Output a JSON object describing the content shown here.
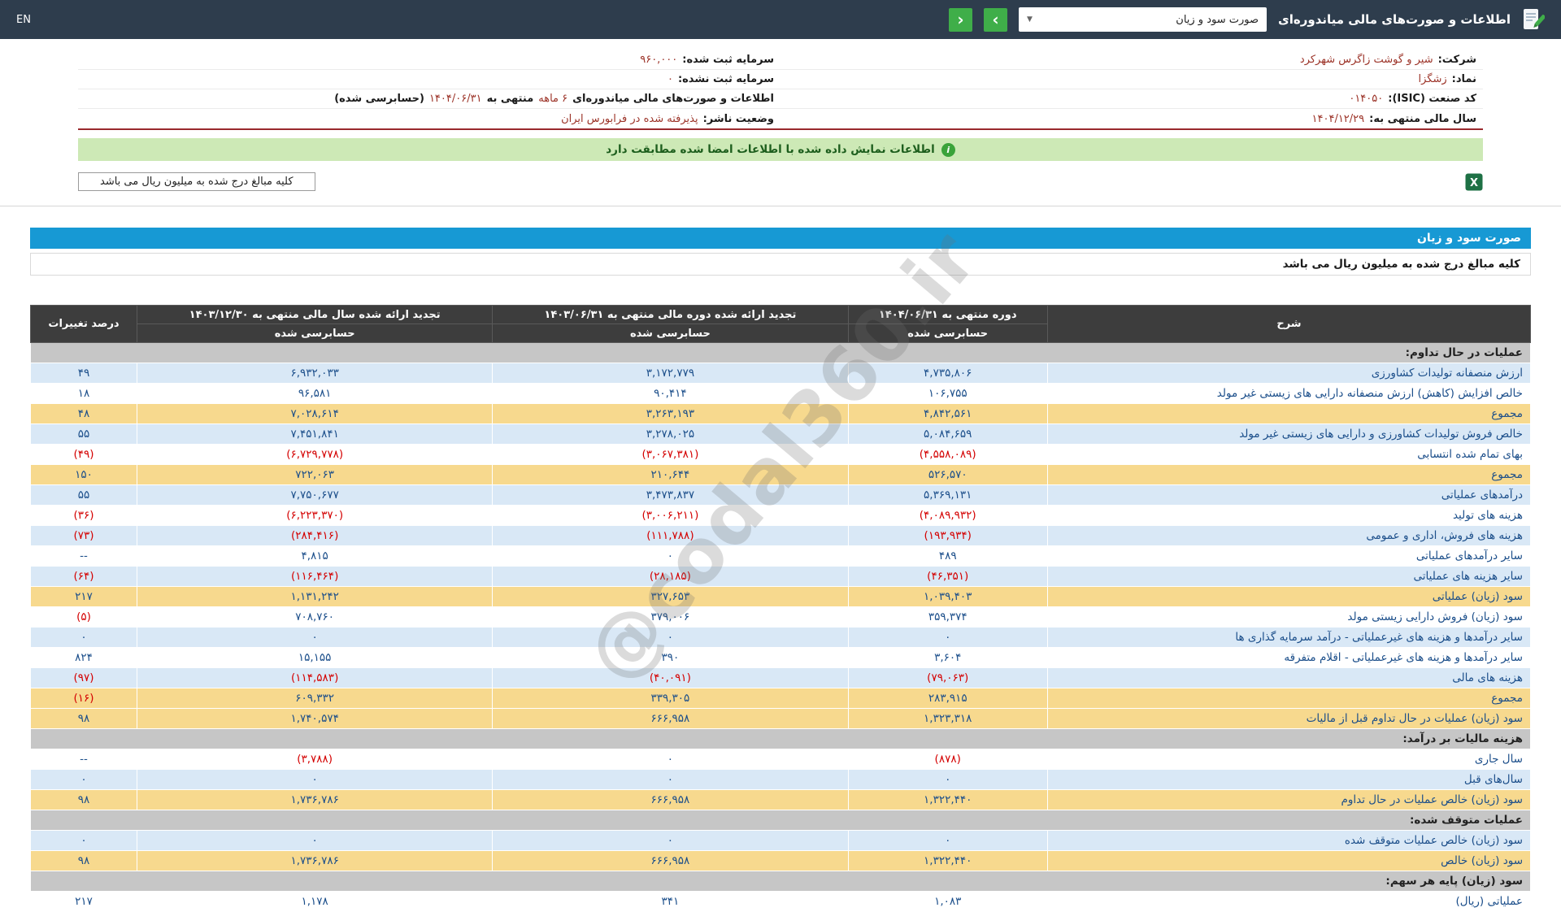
{
  "colors": {
    "topbar": "#2e3d4d",
    "accent_blue": "#1799d4",
    "nav_green": "#3fae49",
    "banner_bg": "#cde9b6",
    "banner_text": "#1d5e1d",
    "row_blue": "#d9e8f6",
    "row_yellow": "#f7d98e",
    "section_gray": "#c6c6c6",
    "negative_red": "#d40000",
    "value_blue": "#1b4e8a",
    "info_value_red": "#9c3328"
  },
  "icons": {
    "select_caret": "▼",
    "nav_back": "‹",
    "nav_forward": "›",
    "info_glyph": "i",
    "excel_glyph": "X"
  },
  "topbar": {
    "title": "اطلاعات و صورت‌های مالی میاندوره‌ای",
    "select_value": "صورت سود و زیان",
    "language": "EN"
  },
  "company": {
    "right_rows": [
      {
        "label": "شرکت:",
        "value": "شیر و گوشت زاگرس شهرکرد"
      },
      {
        "label": "نماد:",
        "value": "زشگزا"
      },
      {
        "label": "کد صنعت (ISIC):",
        "value": "۰۱۴۰۵۰"
      },
      {
        "label": "سال مالی منتهی به:",
        "value": "۱۴۰۴/۱۲/۲۹"
      }
    ],
    "left_rows": [
      {
        "label": "سرمایه ثبت شده:",
        "value": "۹۶۰,۰۰۰"
      },
      {
        "label": "سرمایه ثبت نشده:",
        "value": "۰"
      },
      {
        "label": "اطلاعات و صورت‌های مالی میاندوره‌ای",
        "value": "۶ ماهه",
        "mid": "منتهی به",
        "date": "۱۴۰۴/۰۶/۳۱",
        "suffix": "(حسابرسی شده)"
      },
      {
        "label": "وضعیت ناشر:",
        "value": "پذیرفته شده در فرابورس ایران"
      }
    ]
  },
  "banner": {
    "text": "اطلاعات نمایش داده شده با اطلاعات امضا شده مطابقت دارد"
  },
  "units_note": "کلیه مبالغ درج شده به میلیون ریال می باشد",
  "watermark": "@codal360.ir",
  "statement": {
    "title": "صورت سود و زیان",
    "units": "کلیه مبالغ درج شده به میلیون ریال می باشد",
    "header": {
      "desc": "شرح",
      "col_current": "دوره منتهی به ۱۴۰۴/۰۶/۳۱",
      "col_prior_period": "تجدید ارائه شده دوره مالی منتهی به ۱۴۰۳/۰۶/۳۱",
      "col_prior_year": "تجدید ارائه شده سال مالی منتهی به ۱۴۰۳/۱۲/۳۰",
      "audited": "حسابرسی شده",
      "pct": "درصد تغییرات"
    },
    "rows": [
      {
        "type": "section",
        "label": "عملیات در حال تداوم:"
      },
      {
        "type": "data",
        "style": "blue",
        "label": "ارزش منصفانه تولیدات کشاورزی",
        "v1": "۴,۷۳۵,۸۰۶",
        "v2": "۳,۱۷۲,۷۷۹",
        "v3": "۶,۹۳۲,۰۳۳",
        "pct": "۴۹"
      },
      {
        "type": "data",
        "style": "white",
        "label": "خالص افزایش (کاهش) ارزش منصفانه دارایی های زیستی غیر مولد",
        "v1": "۱۰۶,۷۵۵",
        "v2": "۹۰,۴۱۴",
        "v3": "۹۶,۵۸۱",
        "pct": "۱۸"
      },
      {
        "type": "data",
        "style": "yellow",
        "label": "مجموع",
        "v1": "۴,۸۴۲,۵۶۱",
        "v2": "۳,۲۶۳,۱۹۳",
        "v3": "۷,۰۲۸,۶۱۴",
        "pct": "۴۸"
      },
      {
        "type": "data",
        "style": "blue",
        "label": "خالص فروش تولیدات کشاورزی و دارایی های زیستی غیر مولد",
        "v1": "۵,۰۸۴,۶۵۹",
        "v2": "۳,۲۷۸,۰۲۵",
        "v3": "۷,۴۵۱,۸۴۱",
        "pct": "۵۵"
      },
      {
        "type": "data",
        "style": "white",
        "label": "بهای تمام شده انتسابی",
        "v1": "(۴,۵۵۸,۰۸۹)",
        "v2": "(۳,۰۶۷,۳۸۱)",
        "v3": "(۶,۷۲۹,۷۷۸)",
        "pct": "(۴۹)"
      },
      {
        "type": "data",
        "style": "yellow",
        "label": "مجموع",
        "v1": "۵۲۶,۵۷۰",
        "v2": "۲۱۰,۶۴۴",
        "v3": "۷۲۲,۰۶۳",
        "pct": "۱۵۰"
      },
      {
        "type": "data",
        "style": "blue",
        "label": "درآمدهای عملیاتی",
        "v1": "۵,۳۶۹,۱۳۱",
        "v2": "۳,۴۷۳,۸۳۷",
        "v3": "۷,۷۵۰,۶۷۷",
        "pct": "۵۵"
      },
      {
        "type": "data",
        "style": "white",
        "label": "هزینه های تولید",
        "v1": "(۴,۰۸۹,۹۳۲)",
        "v2": "(۳,۰۰۶,۲۱۱)",
        "v3": "(۶,۲۲۳,۳۷۰)",
        "pct": "(۳۶)"
      },
      {
        "type": "data",
        "style": "blue",
        "label": "هزینه های فروش، اداری و عمومی",
        "v1": "(۱۹۳,۹۳۴)",
        "v2": "(۱۱۱,۷۸۸)",
        "v3": "(۲۸۴,۴۱۶)",
        "pct": "(۷۳)"
      },
      {
        "type": "data",
        "style": "white",
        "label": "سایر درآمدهای عملیاتی",
        "v1": "۴۸۹",
        "v2": "۰",
        "v3": "۴,۸۱۵",
        "pct": "--"
      },
      {
        "type": "data",
        "style": "blue",
        "label": "سایر هزینه های عملیاتی",
        "v1": "(۴۶,۳۵۱)",
        "v2": "(۲۸,۱۸۵)",
        "v3": "(۱۱۶,۴۶۴)",
        "pct": "(۶۴)"
      },
      {
        "type": "data",
        "style": "yellow",
        "label": "سود (زیان) عملیاتی",
        "v1": "۱,۰۳۹,۴۰۳",
        "v2": "۳۲۷,۶۵۳",
        "v3": "۱,۱۳۱,۲۴۲",
        "pct": "۲۱۷"
      },
      {
        "type": "data",
        "style": "white",
        "label": "سود (زیان) فروش دارایی زیستی مولد",
        "v1": "۳۵۹,۳۷۴",
        "v2": "۳۷۹,۰۰۶",
        "v3": "۷۰۸,۷۶۰",
        "pct": "(۵)"
      },
      {
        "type": "data",
        "style": "blue",
        "label": "سایر درآمدها و هزینه های غیرعملیاتی - درآمد سرمایه گذاری ها",
        "v1": "۰",
        "v2": "۰",
        "v3": "۰",
        "pct": "۰"
      },
      {
        "type": "data",
        "style": "white",
        "label": "سایر درآمدها و هزینه های غیرعملیاتی - اقلام متفرقه",
        "v1": "۳,۶۰۴",
        "v2": "۳۹۰",
        "v3": "۱۵,۱۵۵",
        "pct": "۸۲۴"
      },
      {
        "type": "data",
        "style": "blue",
        "label": "هزینه های مالی",
        "v1": "(۷۹,۰۶۳)",
        "v2": "(۴۰,۰۹۱)",
        "v3": "(۱۱۴,۵۸۳)",
        "pct": "(۹۷)"
      },
      {
        "type": "data",
        "style": "yellow",
        "label": "مجموع",
        "v1": "۲۸۳,۹۱۵",
        "v2": "۳۳۹,۳۰۵",
        "v3": "۶۰۹,۳۳۲",
        "pct": "(۱۶)"
      },
      {
        "type": "data",
        "style": "yellow",
        "label": "سود (زیان) عملیات در حال تداوم قبل از مالیات",
        "v1": "۱,۳۲۳,۳۱۸",
        "v2": "۶۶۶,۹۵۸",
        "v3": "۱,۷۴۰,۵۷۴",
        "pct": "۹۸"
      },
      {
        "type": "section",
        "label": "هزینه مالیات بر درآمد:"
      },
      {
        "type": "data",
        "style": "white",
        "label": "سال جاری",
        "v1": "(۸۷۸)",
        "v2": "۰",
        "v3": "(۳,۷۸۸)",
        "pct": "--"
      },
      {
        "type": "data",
        "style": "blue",
        "label": "سال‌های قبل",
        "v1": "۰",
        "v2": "۰",
        "v3": "۰",
        "pct": "۰"
      },
      {
        "type": "data",
        "style": "yellow",
        "label": "سود (زیان) خالص عملیات در حال تداوم",
        "v1": "۱,۳۲۲,۴۴۰",
        "v2": "۶۶۶,۹۵۸",
        "v3": "۱,۷۳۶,۷۸۶",
        "pct": "۹۸"
      },
      {
        "type": "section",
        "label": "عملیات متوقف شده:"
      },
      {
        "type": "data",
        "style": "blue",
        "label": "سود (زیان) خالص عملیات متوقف شده",
        "v1": "۰",
        "v2": "۰",
        "v3": "۰",
        "pct": "۰"
      },
      {
        "type": "data",
        "style": "yellow",
        "label": "سود (زیان) خالص",
        "v1": "۱,۳۲۲,۴۴۰",
        "v2": "۶۶۶,۹۵۸",
        "v3": "۱,۷۳۶,۷۸۶",
        "pct": "۹۸"
      },
      {
        "type": "section",
        "label": "سود (زیان) پایه هر سهم:"
      },
      {
        "type": "data",
        "style": "white",
        "label": "عملیاتی (ریال)",
        "v1": "۱,۰۸۳",
        "v2": "۳۴۱",
        "v3": "۱,۱۷۸",
        "pct": "۲۱۷"
      }
    ]
  }
}
